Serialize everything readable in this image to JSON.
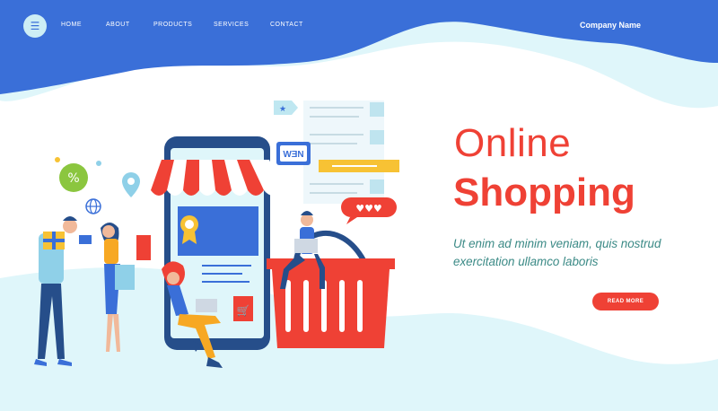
{
  "nav": {
    "menu_icon": "hamburger-icon",
    "items": [
      {
        "label": "HOME"
      },
      {
        "label": "ABOUT"
      },
      {
        "label": "PRODUCTS"
      },
      {
        "label": "SERVICES"
      },
      {
        "label": "CONTACT"
      }
    ],
    "company_name": "Company Name"
  },
  "hero": {
    "title_line1": "Online",
    "title_line2": "Shopping",
    "subtitle": "Ut enim ad minim veniam, quis nostrud exercitation ullamco laboris",
    "cta_label": "READ MORE"
  },
  "illustration": {
    "new_badge": "WƎN",
    "icons": [
      "percent-icon",
      "globe-icon",
      "location-pin-icon",
      "award-badge-icon",
      "cart-icon",
      "heart-icon",
      "star-tag-icon"
    ]
  },
  "colors": {
    "brand_blue": "#3a6fd8",
    "light_cyan": "#dff6fa",
    "accent_red": "#ef4135",
    "text_teal": "#3b8a86"
  }
}
